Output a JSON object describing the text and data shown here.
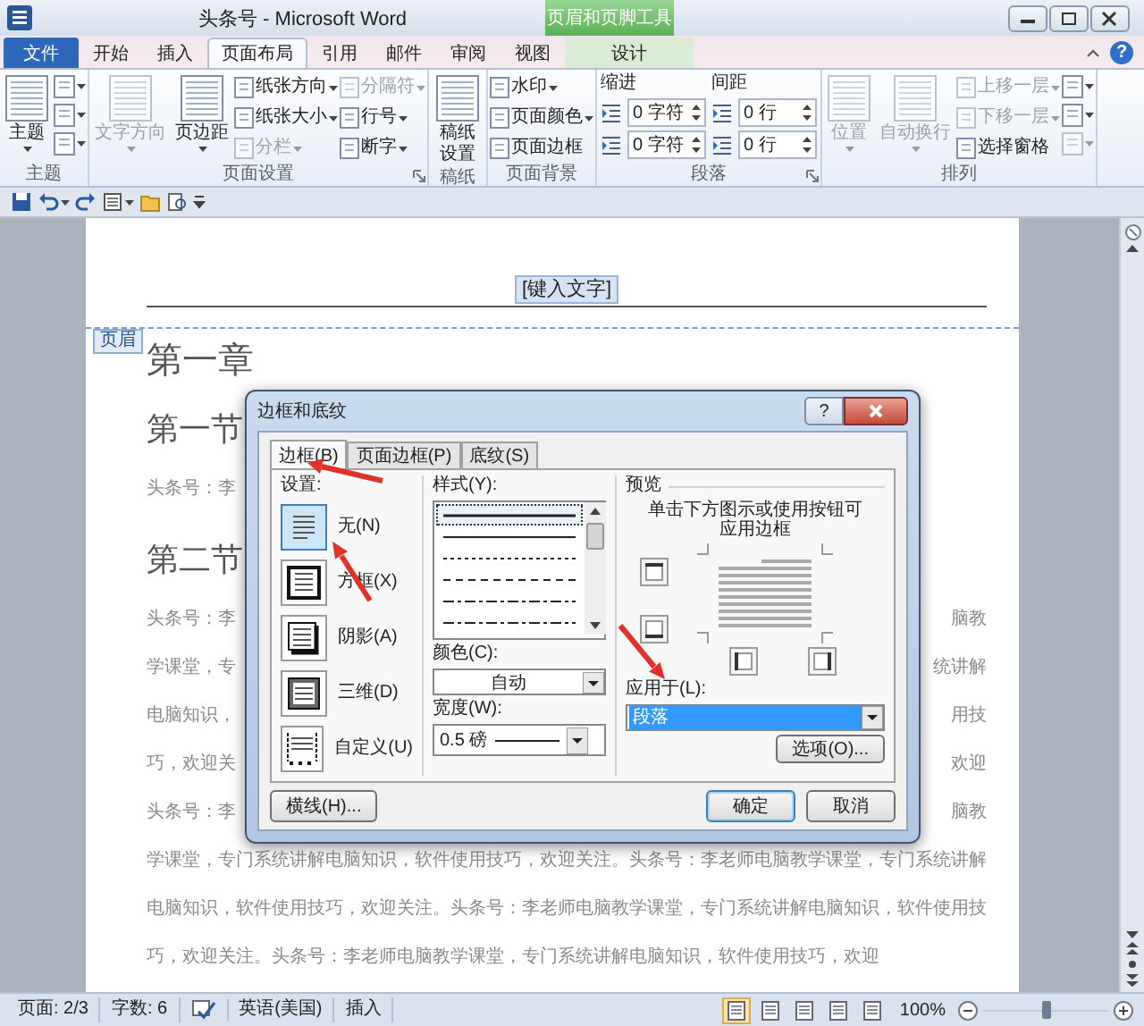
{
  "window": {
    "title": "头条号 - Microsoft Word",
    "context_group": "页眉和页脚工具"
  },
  "ribbon_tabs": [
    {
      "label": "文件",
      "kind": "file",
      "selected": false
    },
    {
      "label": "开始",
      "kind": "normal",
      "selected": false
    },
    {
      "label": "插入",
      "kind": "normal",
      "selected": false
    },
    {
      "label": "页面布局",
      "kind": "normal",
      "selected": true
    },
    {
      "label": "引用",
      "kind": "normal",
      "selected": false
    },
    {
      "label": "邮件",
      "kind": "normal",
      "selected": false
    },
    {
      "label": "审阅",
      "kind": "normal",
      "selected": false
    },
    {
      "label": "视图",
      "kind": "normal",
      "selected": false
    },
    {
      "label": "设计",
      "kind": "context",
      "selected": false
    }
  ],
  "help_button": "?",
  "ribbon_groups": [
    {
      "label": "主题",
      "launcher": false,
      "items": [
        {
          "kind": "large",
          "label": "主题",
          "dropdown": true,
          "disabled": false
        },
        {
          "kind": "icon",
          "dropdown": true,
          "disabled": false
        },
        {
          "kind": "icon",
          "dropdown": true,
          "disabled": false
        },
        {
          "kind": "icon",
          "dropdown": true,
          "disabled": false
        }
      ]
    },
    {
      "label": "页面设置",
      "launcher": true,
      "items": [
        {
          "kind": "large",
          "label": "文字方向",
          "dropdown": true,
          "disabled": true
        },
        {
          "kind": "large",
          "label": "页边距",
          "dropdown": true,
          "disabled": false
        },
        {
          "kind": "small",
          "label": "纸张方向",
          "dropdown": true,
          "disabled": false
        },
        {
          "kind": "small",
          "label": "纸张大小",
          "dropdown": true,
          "disabled": false
        },
        {
          "kind": "small",
          "label": "分栏",
          "dropdown": true,
          "disabled": true
        },
        {
          "kind": "small",
          "label": "分隔符",
          "dropdown": true,
          "disabled": true
        },
        {
          "kind": "small",
          "label": "行号",
          "dropdown": true,
          "disabled": false
        },
        {
          "kind": "small",
          "label": "断字",
          "dropdown": true,
          "disabled": false
        }
      ]
    },
    {
      "label": "稿纸",
      "launcher": false,
      "items": [
        {
          "kind": "large",
          "label": "稿纸设置",
          "dropdown": false,
          "disabled": false
        }
      ]
    },
    {
      "label": "页面背景",
      "launcher": false,
      "items": [
        {
          "kind": "small",
          "label": "水印",
          "dropdown": true,
          "disabled": false
        },
        {
          "kind": "small",
          "label": "页面颜色",
          "dropdown": true,
          "disabled": false
        },
        {
          "kind": "small",
          "label": "页面边框",
          "dropdown": false,
          "disabled": false
        }
      ]
    },
    {
      "label": "段落",
      "launcher": true,
      "items": [
        {
          "kind": "spin",
          "heading": "缩进",
          "fields": [
            "0 字符",
            "0 字符"
          ]
        },
        {
          "kind": "spin",
          "heading": "间距",
          "fields": [
            "0 行",
            "0 行"
          ]
        }
      ]
    },
    {
      "label": "排列",
      "launcher": false,
      "items": [
        {
          "kind": "large",
          "label": "位置",
          "dropdown": true,
          "disabled": true
        },
        {
          "kind": "large",
          "label": "自动换行",
          "dropdown": true,
          "disabled": true
        },
        {
          "kind": "small",
          "label": "上移一层",
          "dropdown": true,
          "disabled": true
        },
        {
          "kind": "small",
          "label": "下移一层",
          "dropdown": true,
          "disabled": true
        },
        {
          "kind": "small",
          "label": "选择窗格",
          "dropdown": false,
          "disabled": false
        },
        {
          "kind": "icon",
          "dropdown": true,
          "disabled": false
        },
        {
          "kind": "icon",
          "dropdown": true,
          "disabled": false
        },
        {
          "kind": "icon",
          "dropdown": true,
          "disabled": true
        }
      ]
    }
  ],
  "document": {
    "header_text": "[键入文字]",
    "header_tag": "页眉",
    "body": [
      {
        "kind": "chapter",
        "text": "第一章"
      },
      {
        "kind": "section",
        "text": "第一节"
      },
      {
        "kind": "split",
        "left": "头条号：李"
      },
      {
        "kind": "section",
        "text": "第二节"
      },
      {
        "kind": "split",
        "left": "头条号：李",
        "right": "脑教"
      },
      {
        "kind": "split",
        "left": "学课堂，专",
        "right": "统讲解"
      },
      {
        "kind": "split",
        "left": "电脑知识，",
        "right": "用技"
      },
      {
        "kind": "split",
        "left": "巧，欢迎关",
        "right": "欢迎"
      },
      {
        "kind": "split",
        "left": "头条号：李",
        "right": "脑教"
      },
      {
        "kind": "line",
        "text": "学课堂，专门系统讲解电脑知识，软件使用技巧，欢迎关注。头条号：李老师电脑教学课堂，专门系统讲解"
      },
      {
        "kind": "line",
        "text": "电脑知识，软件使用技巧，欢迎关注。头条号：李老师电脑教学课堂，专门系统讲解电脑知识，软件使用技"
      },
      {
        "kind": "line",
        "text": "巧，欢迎关注。头条号：李老师电脑教学课堂，专门系统讲解电脑知识，软件使用技巧，欢迎"
      }
    ]
  },
  "dialog": {
    "title": "边框和底纹",
    "help": "?",
    "tabs": [
      {
        "label": "边框(B)",
        "selected": true
      },
      {
        "label": "页面边框(P)",
        "selected": false
      },
      {
        "label": "底纹(S)",
        "selected": false
      }
    ],
    "settings_label": "设置:",
    "settings": [
      {
        "label": "无(N)",
        "kind": "none",
        "selected": true
      },
      {
        "label": "方框(X)",
        "kind": "box",
        "selected": false
      },
      {
        "label": "阴影(A)",
        "kind": "shadow",
        "selected": false
      },
      {
        "label": "三维(D)",
        "kind": "threed",
        "selected": false
      },
      {
        "label": "自定义(U)",
        "kind": "custom",
        "selected": false
      }
    ],
    "style_label": "样式(Y):",
    "styles": [
      {
        "kind": "solid",
        "selected": true
      },
      {
        "kind": "solid",
        "selected": false
      },
      {
        "kind": "dotted",
        "selected": false
      },
      {
        "kind": "dashed",
        "selected": false
      },
      {
        "kind": "dashdot",
        "selected": false
      },
      {
        "kind": "dashdot",
        "selected": false
      }
    ],
    "color_label": "颜色(C):",
    "color_choice": "自动",
    "width_label": "宽度(W):",
    "width": "0.5 磅",
    "preview_label": "预览",
    "preview_hint": "单击下方图示或使用按钮可应用边框",
    "apply_label": "应用于(L):",
    "apply_to": "段落",
    "options_button": "选项(O)...",
    "horizontal_line_button": "横线(H)...",
    "ok_button": "确定",
    "cancel_button": "取消"
  },
  "status_bar": {
    "page": "页面: 2/3",
    "words": "字数: 6",
    "language": "英语(美国)",
    "mode": "插入",
    "views": [
      {
        "selected": true
      },
      {
        "selected": false
      },
      {
        "selected": false
      },
      {
        "selected": false
      },
      {
        "selected": false
      }
    ],
    "zoom": "100%",
    "zoom_slider": {
      "level": 0.5
    }
  }
}
